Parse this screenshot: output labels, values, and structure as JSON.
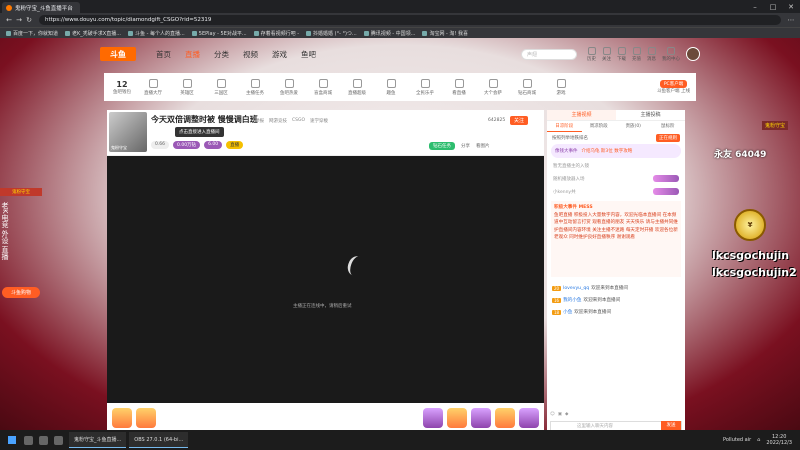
{
  "browser": {
    "tab_title": "鬼粉守宝_斗鱼直播平台",
    "address": "https://www.douyu.com/topic/diamondgift_CSGO?rid=52319",
    "bookmarks": [
      "百度一下，你就知道",
      "老K_秃破手求X直播...",
      "斗鱼 - 每个人的直播...",
      "5EPlay - 5E对战平...",
      "存着看视频行吧 -",
      "抖婚婚婚 (°- °)つ...",
      "腾讯视频 - 中国领...",
      "淘宝网 - 淘! 我喜"
    ]
  },
  "header": {
    "logo": "斗鱼",
    "nav": [
      "首页",
      "直播",
      "分类",
      "视频",
      "游戏",
      "鱼吧"
    ],
    "search_placeholder": "声翅",
    "tools": [
      "历史",
      "关注",
      "下载",
      "充值",
      "消息",
      "我的中心"
    ]
  },
  "categories": {
    "count": "12",
    "count_label": "鱼吧钱包",
    "items": [
      "直播大厅",
      "英雄区",
      "三国区",
      "主播任务",
      "鱼吧热爱",
      "盲盒商城",
      "直播超级",
      "趣鱼",
      "全民乐乎",
      "看直播",
      "大个会萨",
      "钻石商城",
      "游戏"
    ],
    "app_button": "PC客户端",
    "app_note": "斗鱼客户端 上线"
  },
  "player": {
    "title": "今天双倍调整时被 慢慢调白班",
    "meta": [
      "举报",
      "网游竞技",
      "CSGO",
      "速学穿梭"
    ],
    "thumb_label": "鬼粉守宝",
    "tooltip": "点击直接进入直播间",
    "badges": [
      "0.66",
      "0.00万钻",
      "6.00",
      "直播"
    ],
    "room_id": "642825",
    "follow": "关注",
    "video_message": "主播正在连线中，请稍后重试",
    "tools": [
      "钻石任务",
      "分享",
      "看图片"
    ]
  },
  "chat": {
    "tabs1": [
      "主播视频",
      "主播投稿"
    ],
    "tabs2": [
      "日凉阶段",
      "周凉阶段",
      "贵族(0)",
      "鼠标阶"
    ],
    "rule_text": "按照列举地铁排名",
    "rule_btn": "正在规则",
    "rank_title": "像钱大事件",
    "rank_text": "介绍乌龟 斯3位 数字攻略",
    "lines": [
      "暂无直播主的入镜",
      "随机播放器入场",
      "小kenny共"
    ],
    "notice_head": "积极大事件 MESS",
    "notice": "鱼吧直播 积极投入大量数字内容，欢迎光临本直播间 在本频道中互动留言打赏 观看直播的朋友 天天快乐 请与主播共同维护直播间内容环境 关注主播不迷路 每天定时开播 欢迎各位新老观众 同时维护良好直播秩序 谢谢观看",
    "messages": [
      {
        "lv": "20",
        "user": "lovevyu_qq",
        "text": "欢迎来到本直播间"
      },
      {
        "lv": "16",
        "user": "我的小鱼",
        "text": "欢迎来到本直播间"
      },
      {
        "lv": "18",
        "user": "小鱼",
        "text": "欢迎来到本直播间"
      }
    ],
    "input_placeholder": "这里输入聊天内容",
    "send": "发送"
  },
  "ads": {
    "left_title": "鬼粉守宝",
    "left_text": "老K电竞 外设 直播",
    "left_bottom": "斗鱼购物",
    "right_banner": "鬼粉守宝",
    "right_big": "永友 64049",
    "right_lk1": "lkcsgochujin",
    "right_lk2": "lkcsgochujin2"
  },
  "taskbar": {
    "apps": [
      "鬼粉守宝_斗鱼直播...",
      "OBS 27.0.1 (64-bi..."
    ],
    "weather": "Polluted air",
    "time": "12:20",
    "date": "2022/12/3"
  }
}
